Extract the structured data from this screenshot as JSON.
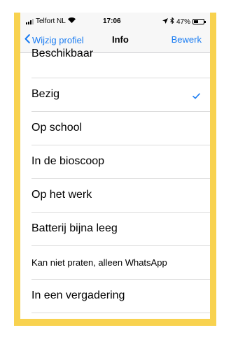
{
  "status_bar": {
    "carrier": "Telfort NL",
    "time": "17:06",
    "battery": "47%",
    "battery_level": 0.47
  },
  "nav": {
    "back_label": "Wijzig profiel",
    "title": "Info",
    "edit_label": "Bewerk"
  },
  "statuses": [
    {
      "label": "Beschikbaar"
    },
    {
      "label": "Bezig",
      "selected": true
    },
    {
      "label": "Op school"
    },
    {
      "label": "In de bioscoop"
    },
    {
      "label": "Op het werk"
    },
    {
      "label": "Batterij bijna leeg"
    },
    {
      "label": "Kan niet praten, alleen WhatsApp"
    },
    {
      "label": "In een vergadering"
    }
  ],
  "colors": {
    "accent": "#1a7cf2",
    "frame": "#f8d24f"
  }
}
